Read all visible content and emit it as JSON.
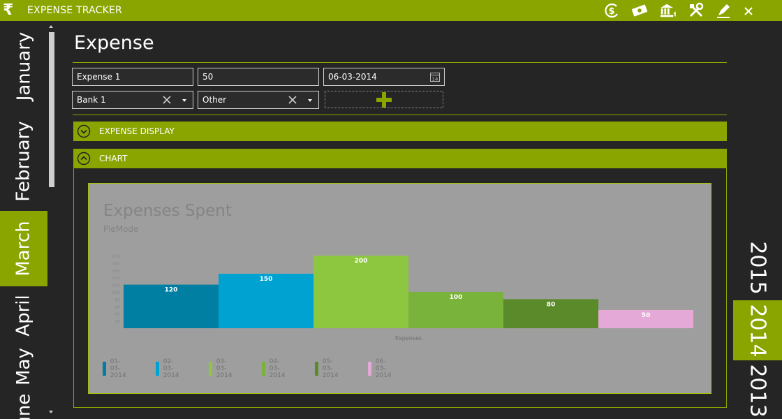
{
  "app": {
    "logo": "₹",
    "title": "EXPENSE TRACKER",
    "toolbar_icons": [
      "currency-icon",
      "cash-icon",
      "bank-icon",
      "tools-icon",
      "edit-icon"
    ]
  },
  "sidebar": {
    "months": [
      "June",
      "May",
      "April",
      "March",
      "February",
      "January"
    ],
    "selected_month": "March"
  },
  "year_strip": {
    "years": [
      "2015",
      "2014",
      "2013"
    ],
    "selected_year": "2014"
  },
  "page": {
    "title": "Expense"
  },
  "form": {
    "name_value": "Expense 1",
    "amount_value": "50",
    "date_value": "06-03-2014",
    "calendar_day": "14",
    "account_value": "Bank 1",
    "category_value": "Other"
  },
  "sections": {
    "expense_display": "EXPENSE DISPLAY",
    "chart": "CHART"
  },
  "colors": {
    "accent": "#8aa500",
    "background": "#252525",
    "chart_bg": "#9e9e9e"
  },
  "chart_data": {
    "type": "bar",
    "title": "Expenses Spent",
    "subtitle": "PieMode",
    "xlabel": "Expenses",
    "ylabel": "",
    "categories": [
      "01-03-2014",
      "02-03-2014",
      "03-03-2014",
      "04-03-2014",
      "05-03-2014",
      "06-03-2014"
    ],
    "values": [
      120,
      150,
      200,
      100,
      80,
      50
    ],
    "colors": [
      "#007fa3",
      "#00a2d2",
      "#8dc63f",
      "#7ab33b",
      "#5b8a2a",
      "#e4a9d6"
    ],
    "y_ticks": [
      "200",
      "180",
      "160",
      "140",
      "120",
      "100",
      "80",
      "60",
      "40",
      "20"
    ],
    "ylim": [
      0,
      200
    ],
    "legend_position": "bottom-left"
  }
}
